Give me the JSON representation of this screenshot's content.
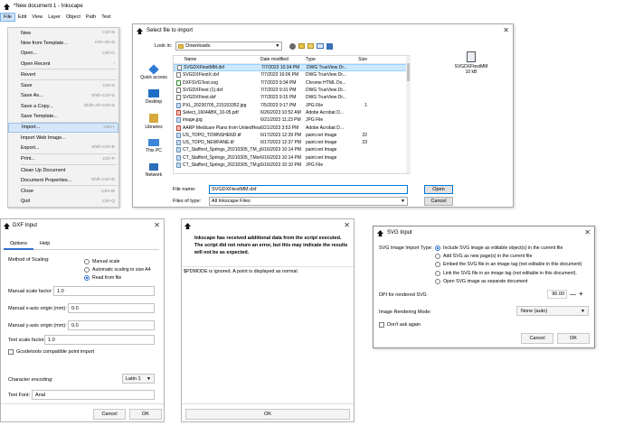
{
  "inkscape": {
    "title": "*New document 1 - Inkscape",
    "menus": [
      "File",
      "Edit",
      "View",
      "Layer",
      "Object",
      "Path",
      "Text"
    ],
    "file_menu": [
      {
        "label": "New",
        "shortcut": "Ctrl+N"
      },
      {
        "label": "New from Template...",
        "shortcut": "Ctrl+Alt+N"
      },
      {
        "label": "Open...",
        "shortcut": "Ctrl+O"
      },
      {
        "label": "Open Recent",
        "shortcut": "›"
      },
      {
        "label": "Revert",
        "shortcut": ""
      },
      {
        "label": "Save",
        "shortcut": "Ctrl+S"
      },
      {
        "label": "Save As...",
        "shortcut": "Shift+Ctrl+S"
      },
      {
        "label": "Save a Copy...",
        "shortcut": "Shift+Alt+Ctrl+S"
      },
      {
        "label": "Save Template...",
        "shortcut": ""
      },
      {
        "label": "Import...",
        "shortcut": "Ctrl+I",
        "highlighted": true
      },
      {
        "label": "Import Web Image...",
        "shortcut": ""
      },
      {
        "label": "Export...",
        "shortcut": "Shift+Ctrl+E"
      },
      {
        "label": "Print...",
        "shortcut": "Ctrl+P"
      },
      {
        "label": "Clean Up Document",
        "shortcut": ""
      },
      {
        "label": "Document Properties...",
        "shortcut": "Shift+Ctrl+D"
      },
      {
        "label": "Close",
        "shortcut": "Ctrl+W"
      },
      {
        "label": "Quit",
        "shortcut": "Ctrl+Q"
      }
    ]
  },
  "file_dialog": {
    "title": "Select file to import",
    "look_in_label": "Look in:",
    "look_in_value": "Downloads",
    "places": [
      "Quick access",
      "Desktop",
      "Libraries",
      "This PC",
      "Network"
    ],
    "columns": [
      "Name",
      "Date modified",
      "Type",
      "Size"
    ],
    "files": [
      {
        "name": "SVGDXFtestMM.dxf",
        "date": "7/7/2023 10:34 PM",
        "type": "DWG TrueView Dr...",
        "size": "",
        "icon": "dxf",
        "selected": true
      },
      {
        "name": "SVGDXFtestX.dxf",
        "date": "7/7/2023 10:06 PM",
        "type": "DWG TrueView Dr...",
        "size": "",
        "icon": "dxf"
      },
      {
        "name": "DXFSVGTest.svg",
        "date": "7/7/2023 9:34 PM",
        "type": "Chrome HTML Do...",
        "size": "",
        "icon": "svg"
      },
      {
        "name": "SVGDXFtest (1).dxf",
        "date": "7/7/2023 9:31 PM",
        "type": "DWG TrueView Dr...",
        "size": "",
        "icon": "dxf"
      },
      {
        "name": "SVGDXFtest.dxf",
        "date": "7/7/2023 9:15 PM",
        "type": "DWG TrueView Dr...",
        "size": "",
        "icon": "dxf"
      },
      {
        "name": "PXL_20230705_215153352.jpg",
        "date": "7/5/2023 9:17 PM",
        "type": "JPG File",
        "size": "1",
        "icon": "img"
      },
      {
        "name": "Select_1604ABK_10-05.pdf",
        "date": "6/26/2023 10:52 AM",
        "type": "Adobe Acrobat D...",
        "size": "",
        "icon": "pdf"
      },
      {
        "name": "image.jpg",
        "date": "6/21/2023 11:23 PM",
        "type": "JPG File",
        "size": "",
        "icon": "img"
      },
      {
        "name": "AARP Medicare Plans from UnitedHealthCar...",
        "date": "6/21/2023 3:53 PM",
        "type": "Adobe Acrobat D...",
        "size": "",
        "icon": "pdf"
      },
      {
        "name": "US_TOPO_TOWNSHEND.tif",
        "date": "6/17/2023 12:39 PM",
        "type": "paint.net Image",
        "size": "22",
        "icon": "img"
      },
      {
        "name": "US_TOPO_NEWFANE.tif",
        "date": "6/17/2023 12:37 PM",
        "type": "paint.net Image",
        "size": "23",
        "icon": "img"
      },
      {
        "name": "CT_Stafford_Springs_20210305_TM_geo.tif",
        "date": "6/16/2023 10:14 PM",
        "type": "paint.net Image",
        "size": "",
        "icon": "img"
      },
      {
        "name": "CT_Stafford_Springs_20210305_TMorth_geo.tif",
        "date": "6/16/2023 10:14 PM",
        "type": "paint.net Image",
        "size": "",
        "icon": "img"
      },
      {
        "name": "CT_Stafford_Springs_20210305_TM.jpg",
        "date": "6/16/2023 10:10 PM",
        "type": "JPG File",
        "size": "",
        "icon": "img"
      }
    ],
    "preview_name": "SVGDXFtestMM",
    "preview_size": "10 kB",
    "file_name_label": "File name:",
    "file_name_value": "SVGDXFtestMM.dxf",
    "file_type_label": "Files of type:",
    "file_type_value": "All Inkscape Files",
    "open_label": "Open",
    "cancel_label": "Cancel"
  },
  "dxf_input": {
    "title": "DXF Input",
    "tabs": [
      "Options",
      "Help"
    ],
    "method_label": "Method of Scaling:",
    "scaling_options": [
      "Manual scale",
      "Automatic scaling to size A4",
      "Read from file"
    ],
    "selected_scaling": 2,
    "manual_scale_label": "Manual scale factor:",
    "manual_scale_value": "1.0",
    "x_origin_label": "Manual x-axis origin (mm):",
    "x_origin_value": "0.0",
    "y_origin_label": "Manual y-axis origin (mm):",
    "y_origin_value": "0.0",
    "text_scale_label": "Text scale factor:",
    "text_scale_value": "1.0",
    "gcodetools_label": "Gcodetools compatible point import",
    "encoding_label": "Character encoding:",
    "encoding_value": "Latin 1",
    "font_label": "Text Font:",
    "font_value": "Arial",
    "cancel_label": "Cancel",
    "ok_label": "OK"
  },
  "error_dialog": {
    "message_bold": "Inkscape has received additional data from the script executed. The script did not return an error, but this may indicate the results will not be as expected.",
    "detail": "$PDMODE is ignored. A point is displayed as normal.",
    "ok_label": "OK"
  },
  "svg_input": {
    "title": "SVG Input",
    "import_type_label": "SVG Image Import Type:",
    "import_options": [
      "Include SVG image as editable object(s) in the current file",
      "Add SVG as new page(s) in the current file",
      "Embed the SVG file in an image tag (not editable in this document)",
      "Link the SVG file in an image tag (not editable in this document).",
      "Open SVG image as separate document"
    ],
    "selected_option": 0,
    "dpi_label": "DPI for rendered SVG",
    "dpi_value": "96.00",
    "rendering_label": "Image Rendering Mode:",
    "rendering_value": "None (auto)",
    "dont_ask_label": "Don't ask again",
    "cancel_label": "Cancel",
    "ok_label": "OK"
  }
}
